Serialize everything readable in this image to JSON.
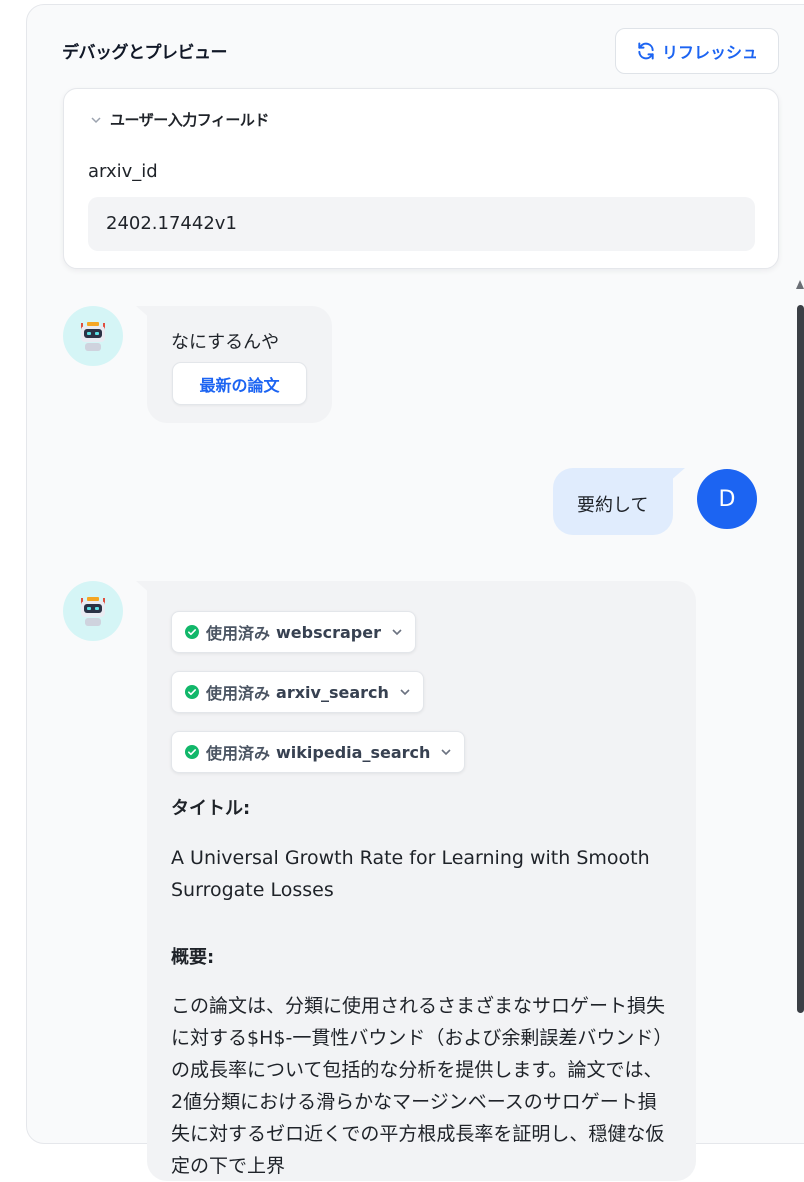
{
  "panel": {
    "title": "デバッグとプレビュー",
    "refresh_label": "リフレッシュ"
  },
  "user_input": {
    "section_title": "ユーザー入力フィールド",
    "field_label": "arxiv_id",
    "field_value": "2402.17442v1"
  },
  "chat": {
    "bot_greeting": "なにするんや",
    "suggested_question": "最新の論文",
    "user_message": "要約して",
    "user_avatar_letter": "D",
    "tools": [
      {
        "status": "使用済み",
        "name": "webscraper"
      },
      {
        "status": "使用済み",
        "name": "arxiv_search"
      },
      {
        "status": "使用済み",
        "name": "wikipedia_search"
      }
    ],
    "title_heading": "タイトル:",
    "title_text": "A Universal Growth Rate for Learning with Smooth Surrogate Losses",
    "summary_heading": "概要:",
    "summary_text": "この論文は、分類に使用されるさまざまなサロゲート損失に対する$H$-一貫性バウンド（および余剰誤差バウンド）の成長率について包括的な分析を提供します。論文では、2値分類における滑らかなマージンベースのサロゲート損失に対するゼロ近くでの平方根成長率を証明し、穏健な仮定の下で上界"
  },
  "colors": {
    "accent": "#1c64f2",
    "success": "#12b76a",
    "bot_avatar_bg": "#d5f5f6"
  },
  "icons": [
    "refresh-icon",
    "chevron-down-icon",
    "robot-icon",
    "check-circle-icon"
  ]
}
